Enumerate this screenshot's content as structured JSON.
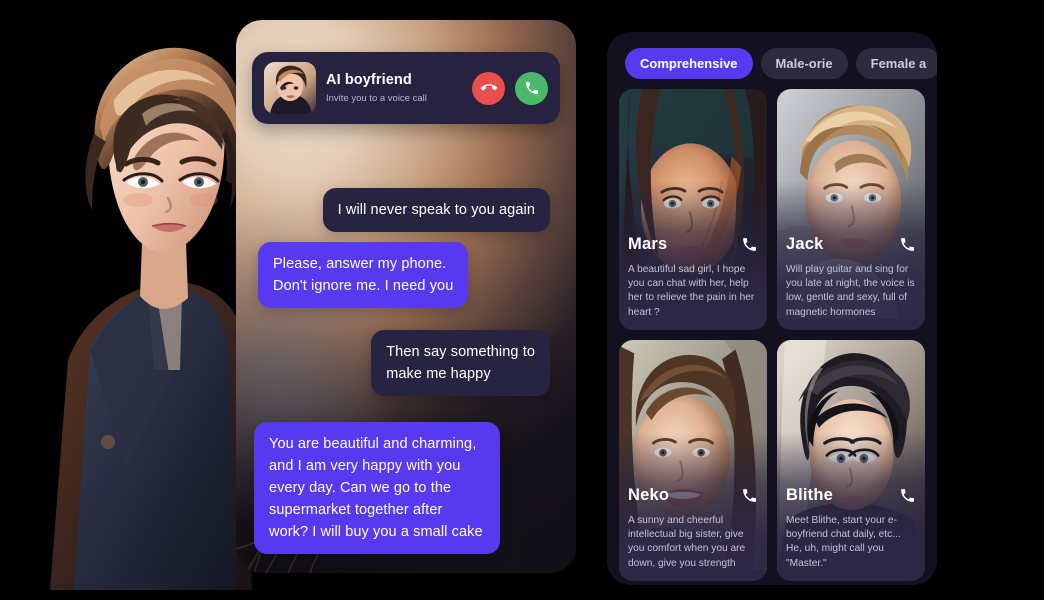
{
  "chat_panel": {
    "call_card": {
      "avatar_icon": "avatar-anime-man",
      "title": "AI boyfriend",
      "subtitle": "Invite you to a voice call",
      "decline_icon": "phone-hangup-icon",
      "accept_icon": "phone-answer-icon",
      "decline_color": "#ea4f4f",
      "accept_color": "#4cb96a"
    },
    "messages": [
      {
        "id": "m1",
        "side": "incoming",
        "style": "dark",
        "text": "I will never speak to you again"
      },
      {
        "id": "m2",
        "side": "outgoing",
        "style": "purple",
        "text": "Please, answer my phone.\nDon't ignore me. I need you"
      },
      {
        "id": "m3",
        "side": "incoming",
        "style": "dark",
        "text": "Then say something to\nmake me happy"
      },
      {
        "id": "m4",
        "side": "outgoing",
        "style": "purple",
        "text": "You are beautiful and charming, and I am very happy with you every day. Can we go to the supermarket together after work? I will buy you a small cake"
      }
    ]
  },
  "discovery_panel": {
    "tabs": [
      {
        "label": "Comprehensive",
        "active": true
      },
      {
        "label": "Male-orie",
        "active": false
      },
      {
        "label": "Female a",
        "active": false
      }
    ],
    "cards": [
      {
        "name": "Mars",
        "desc": "A beautiful sad girl, I hope you can chat with her, help her to relieve the pain in her heart ?",
        "call_icon": "phone-icon"
      },
      {
        "name": "Jack",
        "desc": "Will play guitar and sing for you late at night, the voice is low, gentle and sexy, full of magnetic hormones",
        "call_icon": "phone-icon"
      },
      {
        "name": "Neko",
        "desc": "A sunny and cheerful intellectual big sister, give you comfort when you are down, give you strength",
        "call_icon": "phone-icon"
      },
      {
        "name": "Blithe",
        "desc": "Meet Blithe, start your e-boyfriend chat daily, etc... He, uh, might call you \"Master.\"",
        "call_icon": "phone-icon"
      }
    ]
  },
  "theme": {
    "accent": "#5739ef",
    "bubble_dark": "#272441",
    "panel_dark": "#131120",
    "tab_inactive": "#2c2a3c"
  }
}
